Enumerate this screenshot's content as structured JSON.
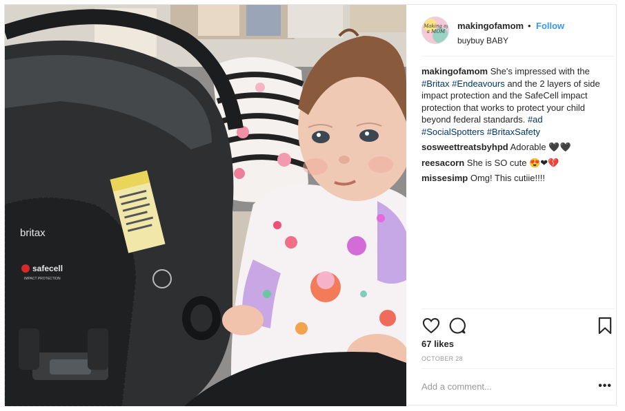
{
  "post": {
    "image_alt": "Baby next to Britax car seat in store",
    "seat_brand": "britax",
    "seat_tech": "safecell",
    "seat_tech_sub": "IMPACT PROTECTION",
    "avatar_text": "Making of a MOM"
  },
  "header": {
    "username": "makingofamom",
    "separator": "•",
    "follow_label": "Follow",
    "location": "buybuy BABY"
  },
  "comments": [
    {
      "user": "makingofamom",
      "parts": [
        {
          "text": "She's impressed with the ",
          "tag": false
        },
        {
          "text": "#Britax",
          "tag": true
        },
        {
          "text": " ",
          "tag": false
        },
        {
          "text": "#Endeavours",
          "tag": true
        },
        {
          "text": " and the 2 layers of side impact protection and the SafeCell impact protection that works to protect your child beyond federal standards. ",
          "tag": false
        },
        {
          "text": "#ad",
          "tag": true
        },
        {
          "text": " ",
          "tag": false
        },
        {
          "text": "#SocialSpotters",
          "tag": true
        },
        {
          "text": " ",
          "tag": false
        },
        {
          "text": "#BritaxSafety",
          "tag": true
        }
      ]
    },
    {
      "user": "sosweettreatsbyhpd",
      "parts": [
        {
          "text": "Adorable 🖤🖤",
          "tag": false
        }
      ]
    },
    {
      "user": "reesacorn",
      "parts": [
        {
          "text": "She is SO cute 😍❤💔",
          "tag": false
        }
      ]
    },
    {
      "user": "missesimp",
      "parts": [
        {
          "text": "Omg! This cutiie!!!!",
          "tag": false
        }
      ]
    }
  ],
  "actions": {
    "likes": "67 likes",
    "date": "OCTOBER 28",
    "icons": [
      "heart-icon",
      "comment-icon",
      "bookmark-icon"
    ]
  },
  "add_comment": {
    "placeholder": "Add a comment...",
    "more_label": "•••"
  },
  "colors": {
    "link_blue": "#3897f0",
    "hashtag": "#003569",
    "muted": "#999999"
  }
}
